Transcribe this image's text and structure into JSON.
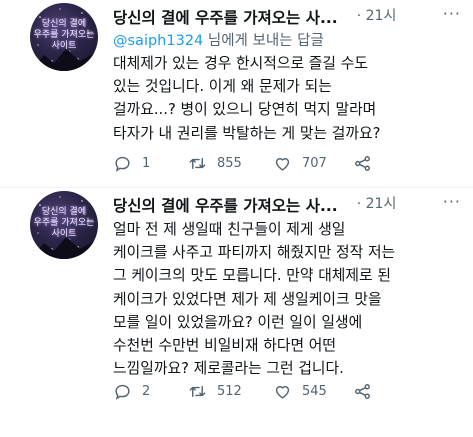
{
  "tweets": [
    {
      "display_name": "당신의 결에 우주를 가져오는 사...",
      "time": "· 21시",
      "more": "···",
      "reply_prefix": "",
      "reply_handle": "@saiph1324",
      "reply_suffix": " 님에게 보내는 답글",
      "body": "대체제가 있는 경우 한시적으로 즐길 수도\n있는 것입니다. 이게 왜 문제가 되는\n걸까요...? 병이 있으니 당연히 먹지 말라며\n타자가 내 권리를 박탈하는 게 맞는 걸까요?",
      "avatar_text": "당신의 결에\n우주를 가져오는\n사이트",
      "replies": "1",
      "retweets": "855",
      "likes": "707"
    },
    {
      "display_name": "당신의 결에 우주를 가져오는 사...",
      "time": "· 21시",
      "more": "···",
      "body": "얼마 전 제 생일때 친구들이 제게 생일\n케이크를 사주고 파티까지 해줬지만 정작 저는\n그 케이크의 맛도 모릅니다. 만약 대체제로 된\n케이크가 있었다면 제가 제 생일케이크 맛을\n모를 일이 있었을까요? 이런 일이 일생에\n수천번 수만번 비일비재 하다면 어떤\n느낌일까요? 제로콜라는 그런 겁니다.",
      "avatar_text": "당신의 결에\n우주를 가져오는\n사이트",
      "replies": "2",
      "retweets": "512",
      "likes": "545"
    }
  ],
  "icons": {
    "reply": "reply-icon",
    "retweet": "retweet-icon",
    "like": "heart-icon",
    "share": "share-icon",
    "more": "more-icon"
  },
  "colors": {
    "text": "#0f1419",
    "secondary": "#536471",
    "link": "#1d9bf0"
  }
}
